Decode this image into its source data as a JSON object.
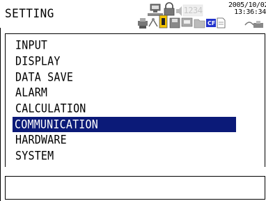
{
  "header": {
    "title": "SETTING",
    "counter": "1234",
    "date": "2005/10/02",
    "time": "13:36:34"
  },
  "status_icons": [
    "network-icon",
    "lock-icon",
    "audio-icon",
    "counter-display",
    "printer-icon",
    "keylock-icon",
    "save-icon",
    "printer2-icon",
    "folder-icon",
    "cf-card-icon",
    "document-icon",
    "network-activity-icon"
  ],
  "menu": {
    "items": [
      "INPUT",
      "DISPLAY",
      "DATA SAVE",
      "ALARM",
      "CALCULATION",
      "COMMUNICATION",
      "HARDWARE",
      "SYSTEM"
    ],
    "selected": "COMMUNICATION"
  },
  "message": "",
  "colors": {
    "selection": "#0b1a78",
    "background": "#ffffff",
    "counter": "#c8c8c8"
  }
}
